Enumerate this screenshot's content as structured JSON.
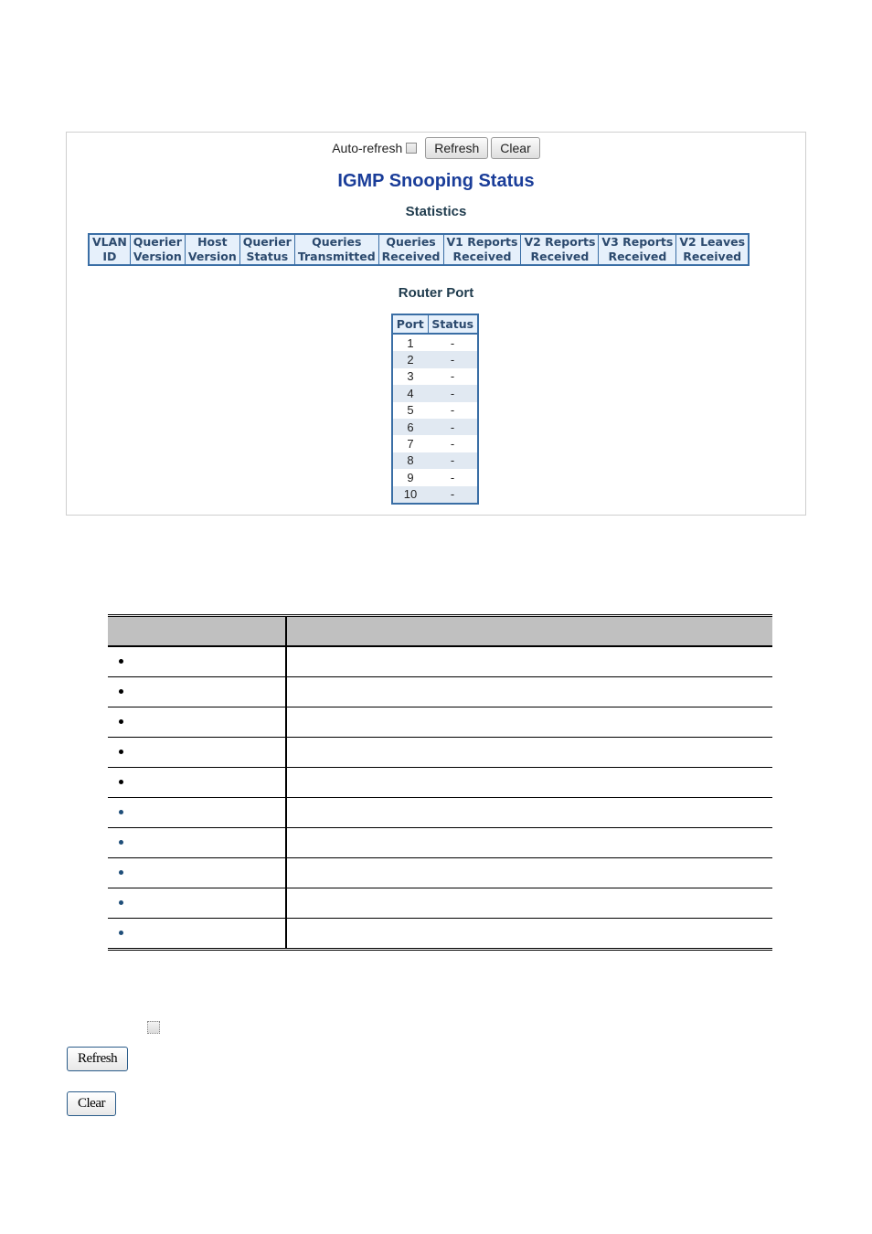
{
  "panel": {
    "toolbar": {
      "auto_refresh_label": "Auto-refresh",
      "auto_refresh_checked": false,
      "refresh_label": "Refresh",
      "clear_label": "Clear"
    },
    "title": "IGMP Snooping Status",
    "statistics": {
      "heading": "Statistics",
      "columns": [
        [
          "VLAN",
          "ID"
        ],
        [
          "Querier",
          "Version"
        ],
        [
          "Host",
          "Version"
        ],
        [
          "Querier",
          "Status"
        ],
        [
          "Queries",
          "Transmitted"
        ],
        [
          "Queries",
          "Received"
        ],
        [
          "V1 Reports",
          "Received"
        ],
        [
          "V2 Reports",
          "Received"
        ],
        [
          "V3 Reports",
          "Received"
        ],
        [
          "V2 Leaves",
          "Received"
        ]
      ]
    },
    "router_port": {
      "heading": "Router Port",
      "columns": [
        "Port",
        "Status"
      ],
      "rows": [
        {
          "port": "1",
          "status": "-"
        },
        {
          "port": "2",
          "status": "-"
        },
        {
          "port": "3",
          "status": "-"
        },
        {
          "port": "4",
          "status": "-"
        },
        {
          "port": "5",
          "status": "-"
        },
        {
          "port": "6",
          "status": "-"
        },
        {
          "port": "7",
          "status": "-"
        },
        {
          "port": "8",
          "status": "-"
        },
        {
          "port": "9",
          "status": "-"
        },
        {
          "port": "10",
          "status": "-"
        }
      ]
    }
  },
  "description_table": {
    "rows": [
      {
        "bullet_color": "#000000"
      },
      {
        "bullet_color": "#000000"
      },
      {
        "bullet_color": "#000000"
      },
      {
        "bullet_color": "#000000"
      },
      {
        "bullet_color": "#000000"
      },
      {
        "bullet_color": "#1f4e79"
      },
      {
        "bullet_color": "#1f4e79"
      },
      {
        "bullet_color": "#1f4e79"
      },
      {
        "bullet_color": "#1f4e79"
      },
      {
        "bullet_color": "#1f4e79"
      }
    ]
  },
  "buttons_section": {
    "auto_refresh_checked": false,
    "refresh_label": "Refresh",
    "clear_label": "Clear"
  }
}
